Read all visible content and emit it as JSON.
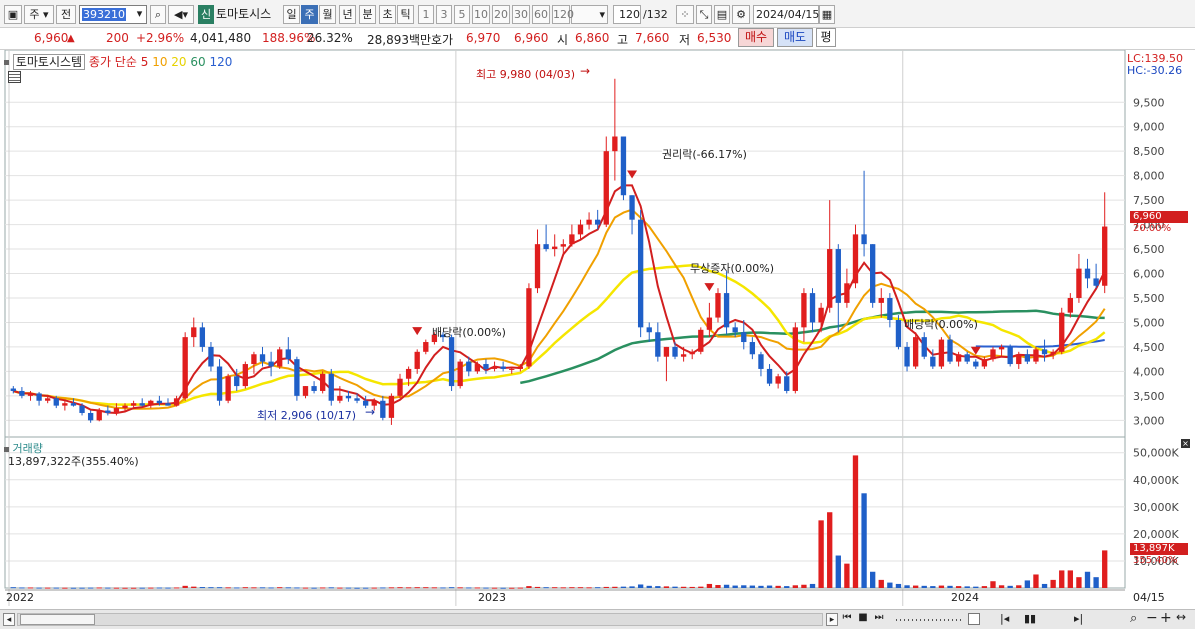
{
  "toolbar": {
    "type_label": "주",
    "prev_label": "전",
    "code": "393210",
    "stock_badge": "신",
    "stock_name": "토마토시스",
    "periods": [
      "일",
      "주",
      "월",
      "년",
      "분",
      "초",
      "틱"
    ],
    "active_period": "주",
    "intervals": [
      "1",
      "3",
      "5",
      "10",
      "20",
      "30",
      "60",
      "120"
    ],
    "count": "120",
    "total": "/132",
    "date": "2024/04/15"
  },
  "quote": {
    "price": "6,960",
    "change": "200",
    "rate": "+2.96%",
    "volume": "4,041,480",
    "vol_ratio": "188.96%",
    "turnover": "26.32%",
    "amount": "28,893백만",
    "bid_label": "호가",
    "bid": "6,970",
    "ask": "6,960",
    "open_label": "시",
    "open": "6,860",
    "high_label": "고",
    "high": "7,660",
    "low_label": "저",
    "low": "6,530",
    "buy": "매수",
    "sell": "매도",
    "eval": "평"
  },
  "legend": {
    "name": "토마토시스템",
    "type": "종가 단순",
    "ma": [
      {
        "label": "5",
        "color": "#d21f1f"
      },
      {
        "label": "10",
        "color": "#f0a000"
      },
      {
        "label": "20",
        "color": "#f5e600"
      },
      {
        "label": "60",
        "color": "#2a9060"
      },
      {
        "label": "120",
        "color": "#2a5fd0"
      }
    ]
  },
  "lc": "LC:139.50",
  "hc": "HC:-30.26",
  "volume_title": "거래량",
  "volume_info": "13,897,322주(355.40%)",
  "x_labels": [
    "2022",
    "2023",
    "2024"
  ],
  "x_date_right": "04/15",
  "price_tag": "6,960",
  "price_pct": "20.00%",
  "vol_tag": "13,897K",
  "vol_pct": "355.40%",
  "annotations": {
    "high": "최고 9,980 (04/03)",
    "low": "최저 2,906 (10/17)",
    "rights": "권리락(-66.17%)",
    "bonus": "무상증자(0.00%)",
    "div1": "배당락(0.00%)",
    "div2": "배당락(0.00%)"
  },
  "chart_data": {
    "type": "candlestick",
    "y_ticks": [
      3000,
      3500,
      4000,
      4500,
      5000,
      5500,
      6000,
      6500,
      7000,
      7500,
      8000,
      8500,
      9000,
      9500
    ],
    "y_range": [
      2700,
      10200
    ],
    "vol_ticks": [
      "10,000K",
      "20,000K",
      "30,000K",
      "40,000K",
      "50,000K"
    ],
    "vol_range": [
      0,
      51000
    ],
    "candles": [
      [
        3650,
        3700,
        3550,
        3600,
        300
      ],
      [
        3600,
        3680,
        3450,
        3500,
        200
      ],
      [
        3500,
        3600,
        3400,
        3550,
        200
      ],
      [
        3550,
        3580,
        3300,
        3400,
        150
      ],
      [
        3400,
        3520,
        3350,
        3450,
        150
      ],
      [
        3450,
        3500,
        3250,
        3300,
        150
      ],
      [
        3300,
        3400,
        3200,
        3350,
        120
      ],
      [
        3350,
        3450,
        3280,
        3300,
        100
      ],
      [
        3300,
        3350,
        3100,
        3150,
        120
      ],
      [
        3150,
        3200,
        2950,
        3000,
        150
      ],
      [
        3000,
        3250,
        2980,
        3200,
        200
      ],
      [
        3200,
        3300,
        3100,
        3150,
        150
      ],
      [
        3150,
        3350,
        3100,
        3250,
        120
      ],
      [
        3250,
        3350,
        3180,
        3300,
        100
      ],
      [
        3300,
        3400,
        3250,
        3350,
        100
      ],
      [
        3350,
        3450,
        3280,
        3300,
        120
      ],
      [
        3300,
        3420,
        3250,
        3400,
        150
      ],
      [
        3400,
        3500,
        3300,
        3350,
        180
      ],
      [
        3350,
        3450,
        3300,
        3300,
        150
      ],
      [
        3300,
        3500,
        3280,
        3450,
        200
      ],
      [
        3450,
        4800,
        3400,
        4700,
        800
      ],
      [
        4700,
        5100,
        4500,
        4900,
        500
      ],
      [
        4900,
        5000,
        4400,
        4500,
        350
      ],
      [
        4500,
        4600,
        4000,
        4100,
        300
      ],
      [
        4100,
        4250,
        3300,
        3400,
        300
      ],
      [
        3400,
        3950,
        3350,
        3900,
        250
      ],
      [
        3900,
        4050,
        3600,
        3700,
        200
      ],
      [
        3700,
        4200,
        3650,
        4150,
        300
      ],
      [
        4150,
        4400,
        3950,
        4350,
        250
      ],
      [
        4350,
        4500,
        4100,
        4200,
        250
      ],
      [
        4200,
        4400,
        3900,
        4100,
        200
      ],
      [
        4100,
        4500,
        4050,
        4450,
        300
      ],
      [
        4450,
        4700,
        4150,
        4250,
        250
      ],
      [
        4250,
        4300,
        3400,
        3500,
        200
      ],
      [
        3500,
        3700,
        3450,
        3700,
        150
      ],
      [
        3700,
        3800,
        3550,
        3600,
        120
      ],
      [
        3600,
        4000,
        3550,
        3950,
        200
      ],
      [
        3950,
        4050,
        3300,
        3400,
        250
      ],
      [
        3400,
        3700,
        3350,
        3500,
        150
      ],
      [
        3500,
        3600,
        3380,
        3450,
        150
      ],
      [
        3450,
        3550,
        3350,
        3400,
        100
      ],
      [
        3400,
        3500,
        3250,
        3300,
        120
      ],
      [
        3300,
        3450,
        3200,
        3400,
        150
      ],
      [
        3400,
        3500,
        3000,
        3050,
        200
      ],
      [
        3050,
        3550,
        2906,
        3500,
        250
      ],
      [
        3500,
        3950,
        3450,
        3850,
        300
      ],
      [
        3850,
        4100,
        3700,
        4050,
        250
      ],
      [
        4050,
        4450,
        3950,
        4400,
        300
      ],
      [
        4400,
        4650,
        4350,
        4600,
        300
      ],
      [
        4600,
        4800,
        4550,
        4750,
        250
      ],
      [
        4750,
        4800,
        4600,
        4700,
        200
      ],
      [
        4700,
        4750,
        3600,
        3700,
        300
      ],
      [
        3700,
        4250,
        3650,
        4200,
        250
      ],
      [
        4200,
        4300,
        3900,
        4000,
        200
      ],
      [
        4000,
        4200,
        3950,
        4150,
        200
      ],
      [
        4150,
        4250,
        3950,
        4050,
        150
      ],
      [
        4050,
        4200,
        4000,
        4100,
        120
      ],
      [
        4100,
        4200,
        4000,
        4050,
        100
      ],
      [
        4050,
        4100,
        3950,
        4050,
        100
      ],
      [
        4050,
        4150,
        4000,
        4100,
        150
      ],
      [
        4100,
        5800,
        4050,
        5700,
        700
      ],
      [
        5700,
        6900,
        5600,
        6600,
        400
      ],
      [
        6600,
        7000,
        6450,
        6500,
        300
      ],
      [
        6500,
        6800,
        6350,
        6550,
        300
      ],
      [
        6550,
        6700,
        6400,
        6600,
        250
      ],
      [
        6600,
        7000,
        6550,
        6800,
        300
      ],
      [
        6800,
        7100,
        6700,
        7000,
        300
      ],
      [
        7000,
        7250,
        6900,
        7100,
        250
      ],
      [
        7100,
        7300,
        6900,
        7000,
        300
      ],
      [
        7000,
        8800,
        6950,
        8500,
        400
      ],
      [
        8500,
        9980,
        7900,
        8800,
        450
      ],
      [
        8800,
        8800,
        7500,
        7600,
        500
      ],
      [
        7600,
        7600,
        6800,
        7100,
        600
      ],
      [
        7100,
        7300,
        4700,
        4900,
        1300
      ],
      [
        4900,
        5000,
        4600,
        4800,
        800
      ],
      [
        4800,
        5000,
        4200,
        4300,
        700
      ],
      [
        4300,
        4500,
        3800,
        4500,
        600
      ],
      [
        4500,
        4600,
        4250,
        4300,
        500
      ],
      [
        4300,
        4500,
        4200,
        4350,
        450
      ],
      [
        4350,
        4450,
        4250,
        4400,
        400
      ],
      [
        4400,
        4900,
        4350,
        4850,
        500
      ],
      [
        4850,
        5400,
        4700,
        5100,
        1500
      ],
      [
        5100,
        5700,
        5000,
        5600,
        1100
      ],
      [
        5600,
        6050,
        4750,
        4900,
        1200
      ],
      [
        4900,
        5000,
        4700,
        4800,
        900
      ],
      [
        4800,
        5050,
        4450,
        4600,
        1000
      ],
      [
        4600,
        4700,
        4250,
        4350,
        900
      ],
      [
        4350,
        4400,
        3900,
        4050,
        800
      ],
      [
        4050,
        4150,
        3700,
        3750,
        900
      ],
      [
        3750,
        3950,
        3650,
        3900,
        800
      ],
      [
        3900,
        4000,
        3550,
        3600,
        700
      ],
      [
        3600,
        5000,
        3550,
        4900,
        1000
      ],
      [
        4900,
        5700,
        4600,
        5600,
        1200
      ],
      [
        5600,
        5700,
        4800,
        5000,
        1500
      ],
      [
        5000,
        5400,
        4800,
        5300,
        25000
      ],
      [
        5300,
        7500,
        5200,
        6500,
        28000
      ],
      [
        6500,
        6600,
        4800,
        5400,
        12000
      ],
      [
        5400,
        6100,
        5300,
        5800,
        9000
      ],
      [
        5800,
        7000,
        5700,
        6800,
        49000
      ],
      [
        6800,
        8100,
        6350,
        6600,
        35000
      ],
      [
        6600,
        6600,
        5300,
        5400,
        6000
      ],
      [
        5400,
        5700,
        5100,
        5500,
        3000
      ],
      [
        5500,
        5600,
        4900,
        5050,
        2000
      ],
      [
        5050,
        5150,
        4450,
        4500,
        1500
      ],
      [
        4500,
        4600,
        4000,
        4100,
        1000
      ],
      [
        4100,
        4800,
        4050,
        4700,
        900
      ],
      [
        4700,
        4800,
        4250,
        4300,
        800
      ],
      [
        4300,
        4450,
        4050,
        4100,
        700
      ],
      [
        4100,
        4700,
        4050,
        4650,
        900
      ],
      [
        4650,
        4750,
        4150,
        4200,
        800
      ],
      [
        4200,
        4400,
        4100,
        4350,
        700
      ],
      [
        4350,
        4400,
        4150,
        4200,
        600
      ],
      [
        4200,
        4250,
        4050,
        4100,
        500
      ],
      [
        4100,
        4300,
        4050,
        4250,
        700
      ],
      [
        4250,
        4500,
        4200,
        4450,
        2500
      ],
      [
        4450,
        4550,
        4300,
        4500,
        1000
      ],
      [
        4500,
        4550,
        4100,
        4150,
        800
      ],
      [
        4150,
        4400,
        4050,
        4350,
        1000
      ],
      [
        4350,
        4450,
        4150,
        4200,
        2800
      ],
      [
        4200,
        4500,
        4150,
        4450,
        5000
      ],
      [
        4450,
        4650,
        4200,
        4350,
        1500
      ],
      [
        4350,
        4450,
        4250,
        4400,
        3000
      ],
      [
        4400,
        5300,
        4350,
        5200,
        6500
      ],
      [
        5200,
        5600,
        5100,
        5500,
        6500
      ],
      [
        5500,
        6400,
        5400,
        6100,
        4000
      ],
      [
        6100,
        6300,
        5700,
        5900,
        6000
      ],
      [
        5900,
        6200,
        5700,
        5750,
        4000
      ],
      [
        5750,
        7660,
        5600,
        6960,
        13897
      ]
    ]
  }
}
